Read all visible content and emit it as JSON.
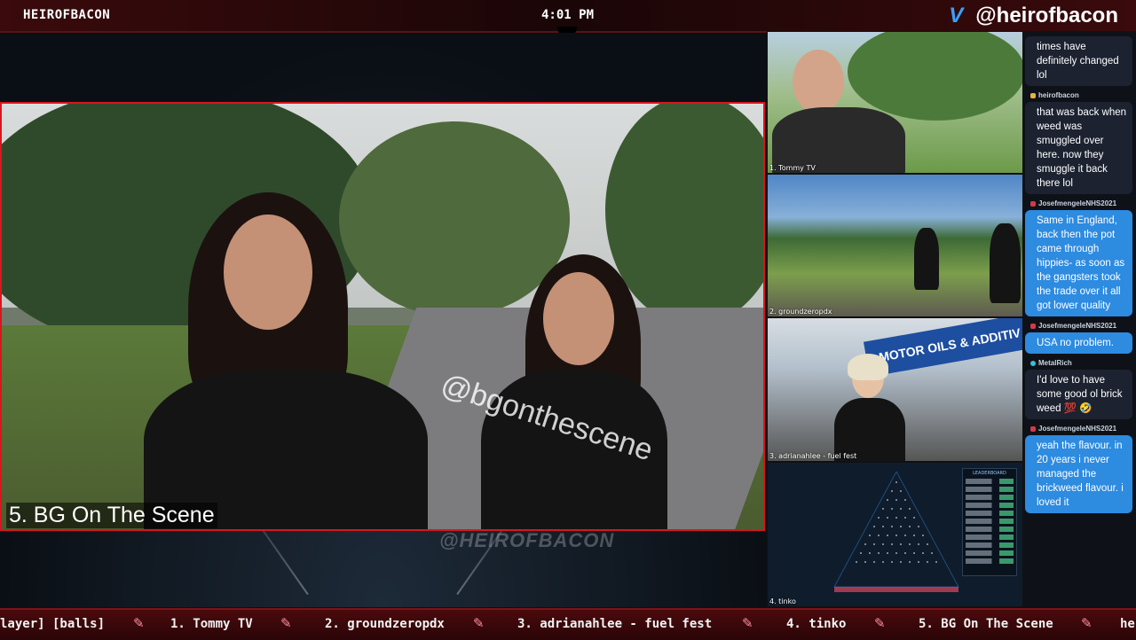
{
  "header": {
    "brand": "HEIROFBACON",
    "time": "4:01 PM",
    "handle": "@heirofbacon"
  },
  "main": {
    "caption": "5. BG On The Scene",
    "watermark": "@bgonthescene",
    "overlay_watermark": "@HEIROFBACON"
  },
  "cams": [
    {
      "label": "1. Tommy TV"
    },
    {
      "label": "2. groundzeropdx"
    },
    {
      "label": "3. adrianahlee - fuel fest",
      "banner": "MOTOR OILS & ADDITIV"
    },
    {
      "label": "4. tinko",
      "leaderboard_title": "LEADERBOARD"
    }
  ],
  "chat": {
    "messages": [
      {
        "user": "",
        "text": "times have definitely changed lol",
        "highlight": false
      },
      {
        "user": "heirofbacon",
        "text": "that was back when weed was smuggled over here. now they smuggle it back there lol",
        "highlight": false,
        "badge": "#e7b23a"
      },
      {
        "user": "JosefmengeleNHS2021",
        "text": "Same in England, back then the pot came through hippies- as soon as the gangsters took the trade over it all got lower quality",
        "highlight": true,
        "badge": "#d23a4b"
      },
      {
        "user": "JosefmengeleNHS2021",
        "text": "USA no problem.",
        "highlight": true,
        "badge": "#d23a4b"
      },
      {
        "user": "MetalRich",
        "text": "I'd love to have some good ol brick weed 💯 🤣",
        "highlight": false,
        "badge": "#37c0d8"
      },
      {
        "user": "JosefmengeleNHS2021",
        "text": "yeah the flavour. in 20 years i never managed the brickweed flavour. i loved it",
        "highlight": true,
        "badge": "#d23a4b"
      }
    ]
  },
  "ticker": {
    "items": [
      "layer] [balls]",
      "1. Tommy TV",
      "2. groundzeropdx",
      "3. adrianahlee - fuel fest",
      "4. tinko",
      "5. BG On The Scene",
      "he"
    ]
  }
}
